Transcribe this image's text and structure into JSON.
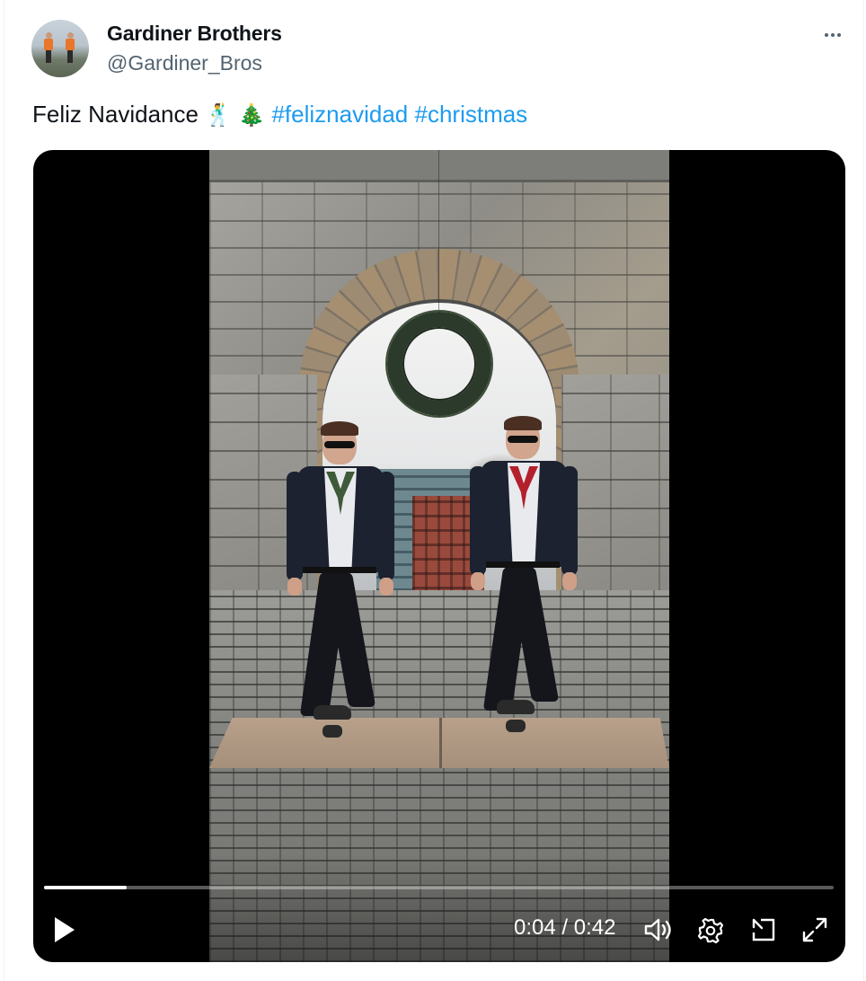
{
  "author": {
    "display_name": "Gardiner Brothers",
    "handle": "@Gardiner_Bros"
  },
  "more_label": "More",
  "tweet": {
    "text": "Feliz Navidance",
    "emoji_1": "🕺",
    "emoji_2": "🎄",
    "hashtags": [
      "#feliznavidad",
      "#christmas"
    ]
  },
  "video": {
    "current_time": "0:04",
    "separator": "/",
    "duration": "0:42",
    "progress_fraction": 0.105,
    "icons": {
      "play": "play-icon",
      "volume": "volume-icon",
      "settings": "settings-gear-icon",
      "pip": "picture-in-picture-icon",
      "fullscreen": "fullscreen-expand-icon"
    }
  },
  "colors": {
    "link": "#1d9bf0",
    "text_primary": "#0f1419",
    "text_secondary": "#536471",
    "vest_left": "#3f5a3a",
    "vest_right": "#b3202b"
  }
}
